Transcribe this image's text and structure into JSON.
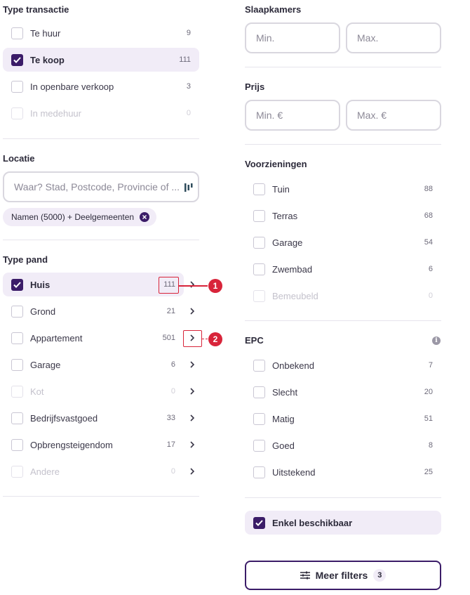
{
  "type_transactie": {
    "title": "Type transactie",
    "items": [
      {
        "label": "Te huur",
        "count": "9",
        "checked": false,
        "disabled": false
      },
      {
        "label": "Te koop",
        "count": "111",
        "checked": true,
        "disabled": false
      },
      {
        "label": "In openbare verkoop",
        "count": "3",
        "checked": false,
        "disabled": false
      },
      {
        "label": "In medehuur",
        "count": "0",
        "checked": false,
        "disabled": true
      }
    ]
  },
  "locatie": {
    "title": "Locatie",
    "placeholder": "Waar? Stad, Postcode, Provincie of ...",
    "chip": "Namen (5000) + Deelgemeenten"
  },
  "type_pand": {
    "title": "Type pand",
    "items": [
      {
        "label": "Huis",
        "count": "111",
        "checked": true,
        "disabled": false
      },
      {
        "label": "Grond",
        "count": "21",
        "checked": false,
        "disabled": false
      },
      {
        "label": "Appartement",
        "count": "501",
        "checked": false,
        "disabled": false
      },
      {
        "label": "Garage",
        "count": "6",
        "checked": false,
        "disabled": false
      },
      {
        "label": "Kot",
        "count": "0",
        "checked": false,
        "disabled": true
      },
      {
        "label": "Bedrijfsvastgoed",
        "count": "33",
        "checked": false,
        "disabled": false
      },
      {
        "label": "Opbrengsteigendom",
        "count": "17",
        "checked": false,
        "disabled": false
      },
      {
        "label": "Andere",
        "count": "0",
        "checked": false,
        "disabled": true
      }
    ]
  },
  "annotations": {
    "one": "1",
    "two": "2"
  },
  "slaapkamers": {
    "title": "Slaapkamers",
    "min_placeholder": "Min.",
    "max_placeholder": "Max."
  },
  "prijs": {
    "title": "Prijs",
    "min_placeholder": "Min. €",
    "max_placeholder": "Max. €"
  },
  "voorzieningen": {
    "title": "Voorzieningen",
    "items": [
      {
        "label": "Tuin",
        "count": "88",
        "checked": false,
        "disabled": false
      },
      {
        "label": "Terras",
        "count": "68",
        "checked": false,
        "disabled": false
      },
      {
        "label": "Garage",
        "count": "54",
        "checked": false,
        "disabled": false
      },
      {
        "label": "Zwembad",
        "count": "6",
        "checked": false,
        "disabled": false
      },
      {
        "label": "Bemeubeld",
        "count": "0",
        "checked": false,
        "disabled": true
      }
    ]
  },
  "epc": {
    "title": "EPC",
    "info_icon": "info-icon",
    "items": [
      {
        "label": "Onbekend",
        "count": "7",
        "checked": false,
        "disabled": false
      },
      {
        "label": "Slecht",
        "count": "20",
        "checked": false,
        "disabled": false
      },
      {
        "label": "Matig",
        "count": "51",
        "checked": false,
        "disabled": false
      },
      {
        "label": "Goed",
        "count": "8",
        "checked": false,
        "disabled": false
      },
      {
        "label": "Uitstekend",
        "count": "25",
        "checked": false,
        "disabled": false
      }
    ]
  },
  "enkel_beschikbaar": {
    "label": "Enkel beschikbaar",
    "checked": true
  },
  "meer_filters": {
    "label": "Meer filters",
    "count": "3"
  },
  "colors": {
    "accent": "#3b1c68",
    "selected_bg": "#f1ecf7",
    "annotation": "#d8243a"
  }
}
